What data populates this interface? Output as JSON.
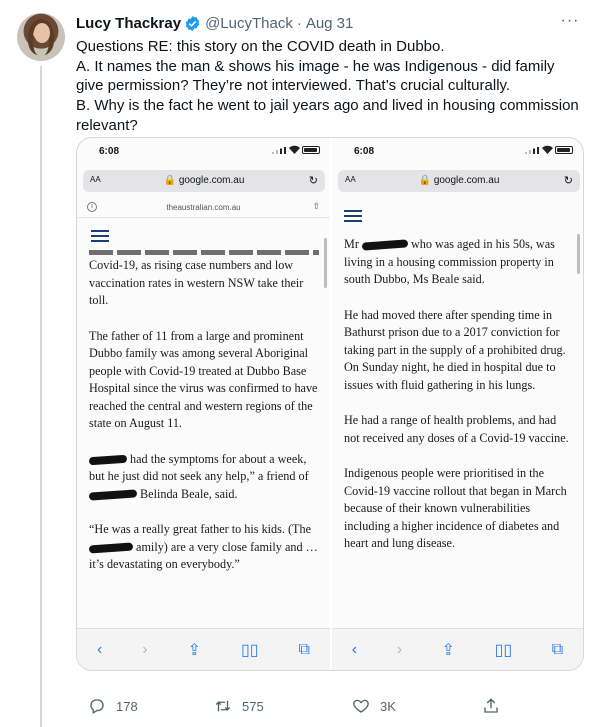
{
  "author": {
    "name": "Lucy Thackray",
    "handle": "@LucyThack",
    "separator": "·",
    "date": "Aug 31"
  },
  "tweet": {
    "lines": [
      "Questions RE: this story on the COVID death in Dubbo.",
      "A. It names the man & shows his image - he was Indigenous - did family give permission? They’re not interviewed. That’s crucial culturally.",
      "B. Why is the fact he went to jail years ago and lived in housing commission relevant?"
    ]
  },
  "screens": [
    {
      "time": "6:08",
      "aa": "AA",
      "url": "google.com.au",
      "site": "theaustralian.com.au",
      "paragraphs": [
        "Covid-19, as rising case numbers and low vaccination rates in western NSW take their toll.",
        "The father of 11 from a large and prominent Dubbo family was among several Aboriginal people with Covid-19 treated at Dubbo Base Hospital since the virus was confirmed to have reached the central and western regions of the state on August 11.",
        "had the symptoms for about a week, but he just did not seek any help,” a friend of",
        "Belinda Beale, said.",
        "“He was a really great father to his kids. (The",
        "amily) are a very close family and … it’s devastating on everybody.”"
      ]
    },
    {
      "time": "6:08",
      "aa": "AA",
      "url": "google.com.au",
      "paragraphs": [
        "Mr",
        "who was aged in his 50s, was living in a housing commission property in south Dubbo, Ms Beale said.",
        "He had moved there after spending time in Bathurst prison due to a 2017 conviction for taking part in the supply of a prohibited drug. On Sunday night, he died in hospital due to issues with fluid gathering in his lungs.",
        "He had a range of health problems, and had not received any doses of a Covid-19 vaccine.",
        "Indigenous people were prioritised in the Covid-19 vaccine rollout that began in March because of their known vulnerabilities including a higher incidence of diabetes and heart and lung disease."
      ]
    }
  ],
  "actions": {
    "replies": "178",
    "retweets": "575",
    "likes": "3K"
  },
  "colors": {
    "verified": "#1d9bf0",
    "text": "#0f1419",
    "secondary": "#536471",
    "ios_link": "#2a7cf6"
  }
}
